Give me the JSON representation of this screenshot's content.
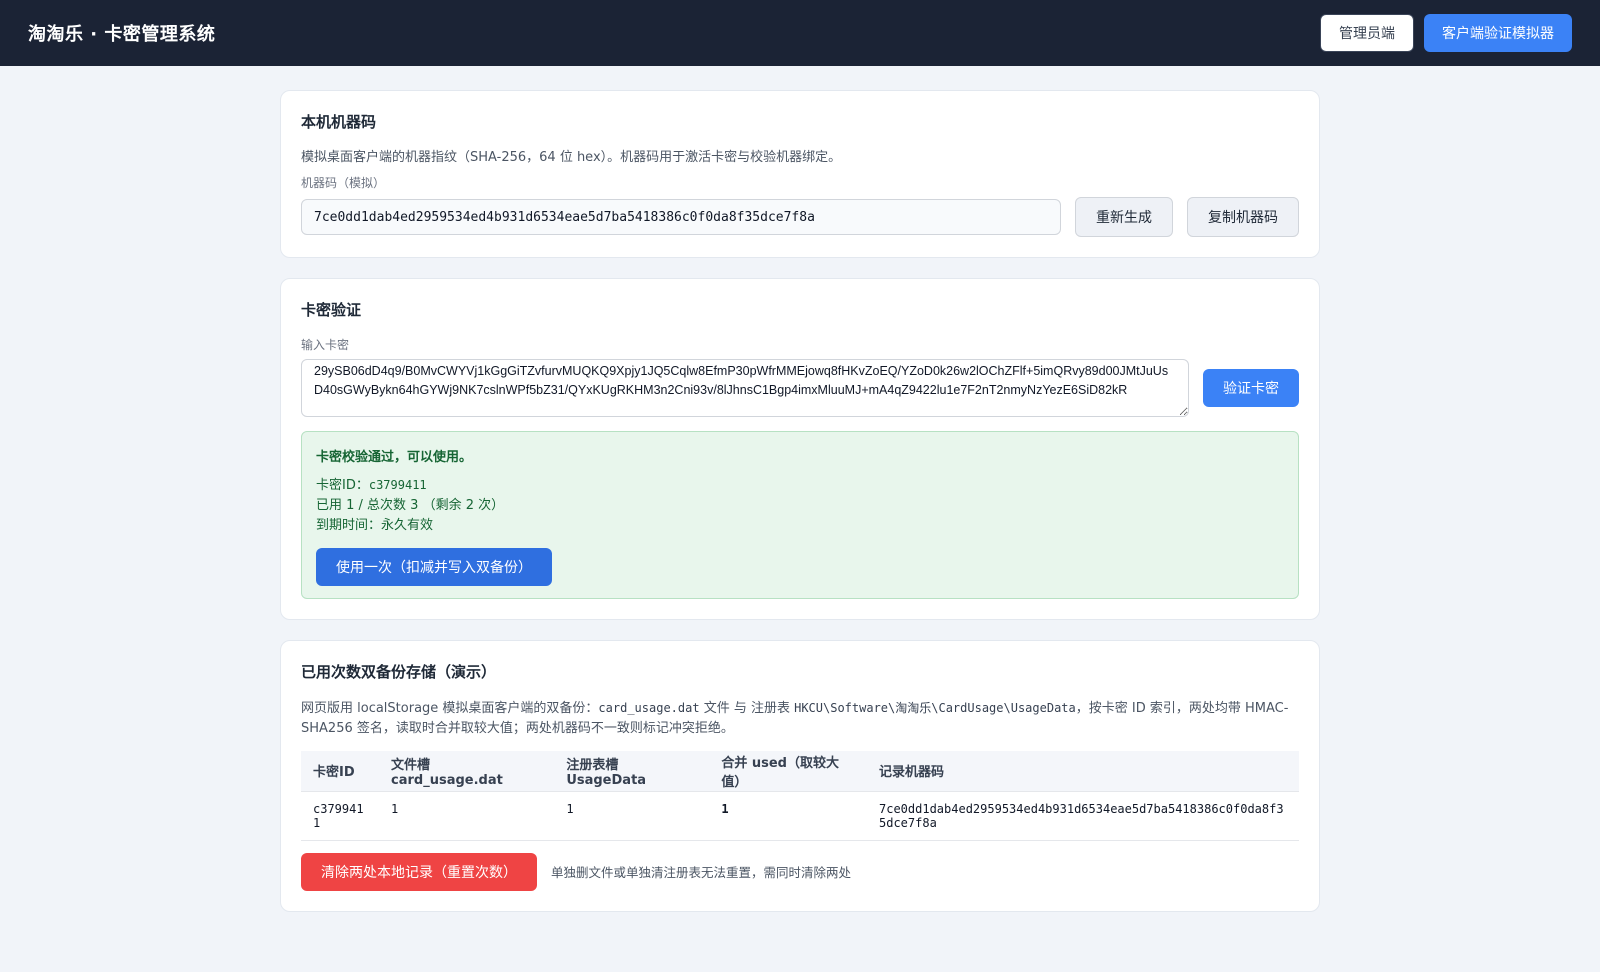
{
  "header": {
    "brand": "淘淘乐 · 卡密管理系统",
    "admin_btn": "管理员端",
    "simulator_btn": "客户端验证模拟器"
  },
  "machine": {
    "title": "本机机器码",
    "desc": "模拟桌面客户端的机器指纹（SHA-256，64 位 hex）。机器码用于激活卡密与校验机器绑定。",
    "label": "机器码（模拟）",
    "value": "7ce0dd1dab4ed2959534ed4b931d6534eae5d7ba5418386c0f0da8f35dce7f8a",
    "regen_btn": "重新生成",
    "copy_btn": "复制机器码"
  },
  "verify": {
    "title": "卡密验证",
    "label": "输入卡密",
    "card_value": "29ySB06dD4q9/B0MvCWYVj1kGgGiTZvfurvMUQKQ9Xpjy1JQ5Cqlw8EfmP30pWfrMMEjowq8fHKvZoEQ/YZoD0k26w2lOChZFlf+5imQRvy89d00JMtJuUsD40sGWyBykn64hGYWj9NK7cslnWPf5bZ31/QYxKUgRKHM3n2Cni93v/8lJhnsC1Bgp4imxMluuMJ+mA4qZ9422lu1e7F2nT2nmyNzYezE6SiD82kR",
    "verify_btn": "验证卡密",
    "success_title": "卡密校验通过，可以使用。",
    "id_label": "卡密ID：",
    "id_value": "c3799411",
    "usage_line": "已用 1 / 总次数 3 （剩余 2 次）",
    "expire_line": "到期时间：永久有效",
    "use_btn": "使用一次（扣减并写入双备份）"
  },
  "storage": {
    "title": "已用次数双备份存储（演示）",
    "desc_1": "网页版用 localStorage 模拟桌面客户端的双备份：",
    "desc_code_1": "card_usage.dat",
    "desc_2": " 文件 与 注册表 ",
    "desc_code_2": "HKCU\\Software\\淘淘乐\\CardUsage\\UsageData",
    "desc_3": "，按卡密 ID 索引，两处均带 HMAC-SHA256 签名，读取时合并取较大值；两处机器码不一致则标记冲突拒绝。",
    "columns": [
      "卡密ID",
      "文件槽 card_usage.dat",
      "注册表槽 UsageData",
      "合并 used（取较大值）",
      "记录机器码"
    ],
    "rows": [
      {
        "id": "c3799411",
        "file": "1",
        "reg": "1",
        "merged": "1",
        "machine": "7ce0dd1dab4ed2959534ed4b931d6534eae5d7ba5418386c0f0da8f35dce7f8a"
      }
    ],
    "clear_btn": "清除两处本地记录（重置次数）",
    "hint": "单独删文件或单独清注册表无法重置，需同时清除两处"
  }
}
